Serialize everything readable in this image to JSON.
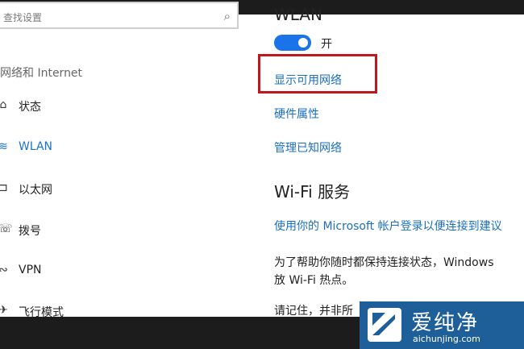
{
  "search": {
    "placeholder": "查找设置",
    "icon": "search-icon"
  },
  "sidebar": {
    "section_title": "网络和 Internet",
    "items": [
      {
        "label": "状态",
        "icon": "home-icon",
        "glyph": "⌂",
        "active": false
      },
      {
        "label": "WLAN",
        "icon": "wifi-icon",
        "glyph": "≋",
        "active": true
      },
      {
        "label": "以太网",
        "icon": "ethernet-icon",
        "glyph": "⊐",
        "active": false
      },
      {
        "label": "拨号",
        "icon": "phone-icon",
        "glyph": "☏",
        "active": false
      },
      {
        "label": "VPN",
        "icon": "vpn-icon",
        "glyph": "∾",
        "active": false
      },
      {
        "label": "飞行模式",
        "icon": "airplane-icon",
        "glyph": "✈",
        "active": false
      }
    ]
  },
  "main": {
    "title": "WLAN",
    "toggle": {
      "label": "开",
      "on": true
    },
    "links": {
      "show_networks": "显示可用网络",
      "hardware_props": "硬件属性",
      "manage_known": "管理已知网络"
    },
    "wifi_services": {
      "title": "Wi-Fi 服务",
      "signin_link": "使用你的 Microsoft 帐户登录以便连接到建议",
      "para_line1": "为了帮助你随时都保持连接状态，Windows",
      "para_line2": "放 Wi-Fi 热点。",
      "para2": "请记住，并非所"
    }
  },
  "watermark": {
    "cn": "爱纯净",
    "en": "aichunjing.com",
    "icon": "aichunjing-logo-icon",
    "color": "#1f5f99"
  },
  "colors": {
    "accent": "#1a73e8",
    "link": "#1a6fc0",
    "highlight": "#c0161c"
  }
}
